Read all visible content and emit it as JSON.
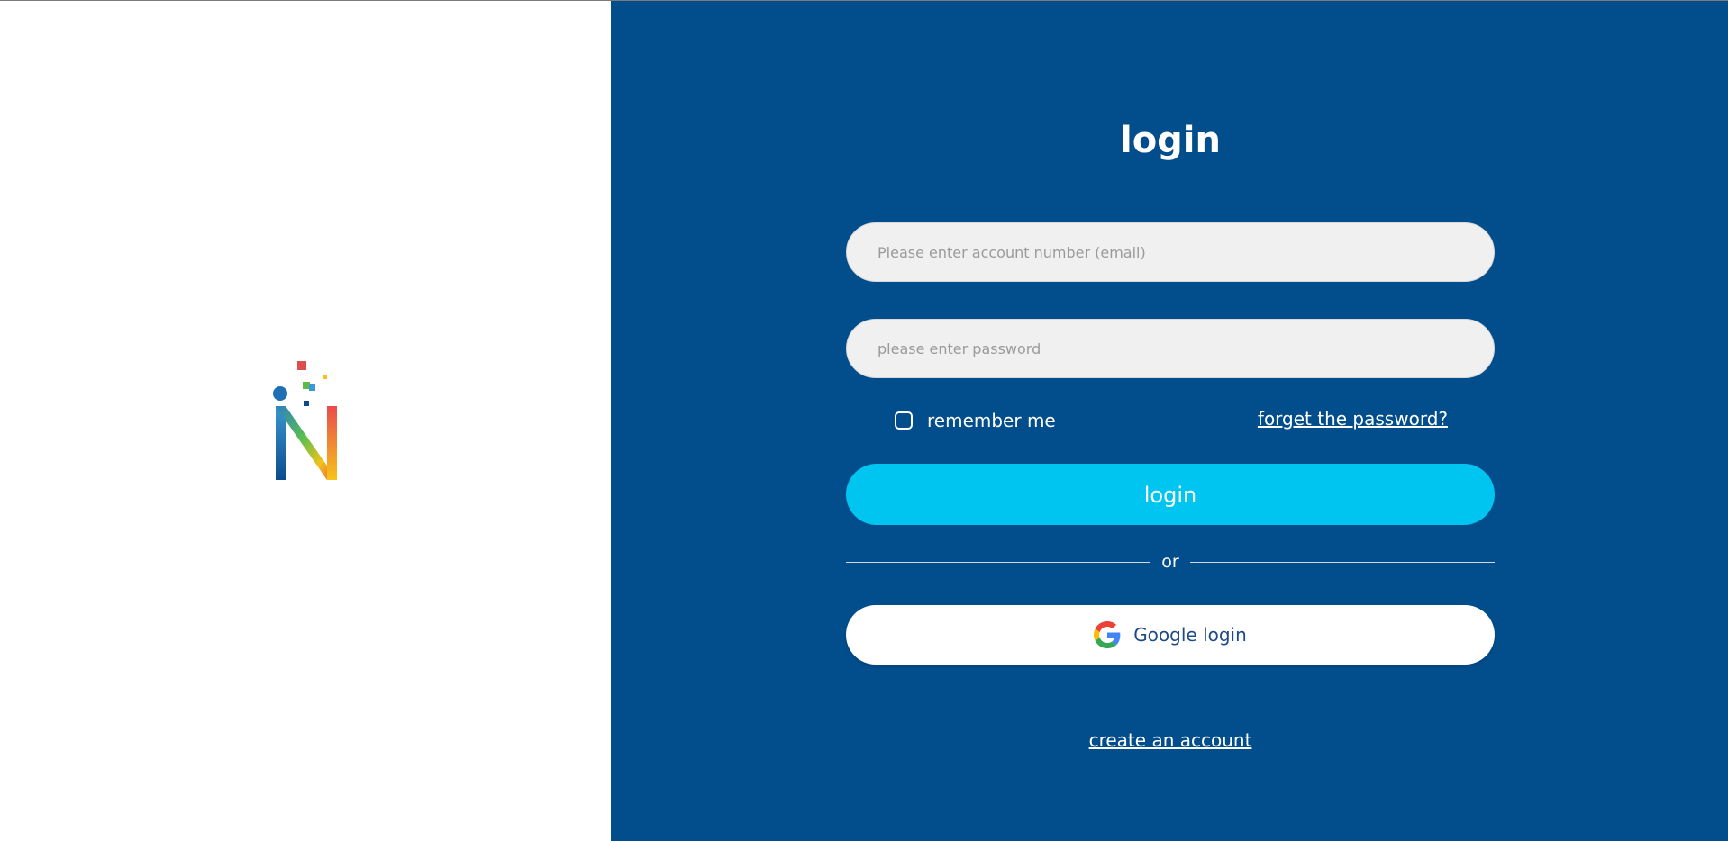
{
  "brand": {
    "logo_icon": "n-logo-icon",
    "colors": {
      "left_background": "#ffffff",
      "right_background": "#024d8c",
      "login_button": "#00c5f0",
      "google_button": "#ffffff",
      "google_label": "#1e4a86",
      "field_background": "#f0f0f0"
    }
  },
  "form": {
    "title": "login",
    "email_placeholder": "Please enter account number (email)",
    "email_value": "",
    "password_placeholder": "please enter password",
    "password_value": "",
    "remember_label": "remember me",
    "remember_checked": false,
    "forgot_label": "forget the password?",
    "login_label": "login",
    "divider_label": "or",
    "google_label": "Google login",
    "google_icon": "google-icon",
    "create_account_label": "create an account"
  }
}
